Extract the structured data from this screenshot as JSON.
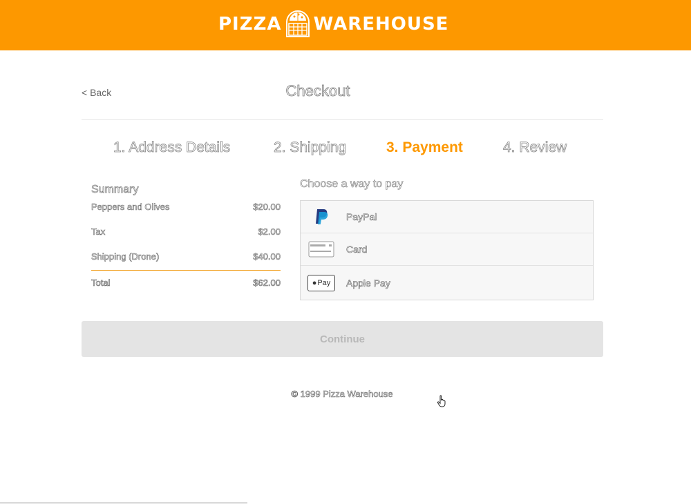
{
  "header": {
    "logo_left": "PIZZA",
    "logo_right": "WAREHOUSE"
  },
  "nav": {
    "back_label": "< Back",
    "page_title": "Checkout"
  },
  "steps": [
    {
      "label": "1. Address Details",
      "active": false
    },
    {
      "label": "2. Shipping",
      "active": false
    },
    {
      "label": "3. Payment",
      "active": true
    },
    {
      "label": "4. Review",
      "active": false
    }
  ],
  "summary": {
    "title": "Summary",
    "items": [
      {
        "name": "Peppers and Olives",
        "price": "$20.00"
      },
      {
        "name": "Tax",
        "price": "$2.00"
      },
      {
        "name": "Shipping (Drone)",
        "price": "$40.00"
      }
    ],
    "total_label": "Total",
    "total_value": "$62.00"
  },
  "payment": {
    "title": "Choose a way to pay",
    "options": [
      {
        "label": "PayPal",
        "icon": "paypal-icon"
      },
      {
        "label": "Card",
        "icon": "credit-card-icon"
      },
      {
        "label": "Apple Pay",
        "icon": "apple-pay-icon",
        "badge": "Pay"
      }
    ]
  },
  "actions": {
    "continue_label": "Continue"
  },
  "footer": {
    "copyright": "© 1999 Pizza Warehouse"
  },
  "colors": {
    "brand": "#fd9800",
    "disabled_button": "#e4e4e4"
  }
}
